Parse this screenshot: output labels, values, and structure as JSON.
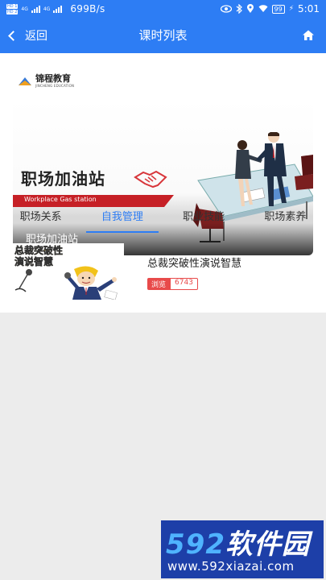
{
  "status_bar": {
    "sim1": "HD 1",
    "sim2": "HD 2",
    "net1": "4G",
    "net2": "4G",
    "speed": "699B/s",
    "battery": "99",
    "time": "5:01"
  },
  "nav": {
    "back_label": "返回",
    "title": "课时列表"
  },
  "logo": {
    "name_cn": "锦程教育",
    "name_en": "JINCHENG EDUCATION"
  },
  "banner": {
    "big_title": "职场加油站",
    "subtitle": "Workplace  Gas station",
    "caption": "职场加油站"
  },
  "tabs": [
    {
      "label": "职场关系",
      "active": false
    },
    {
      "label": "自我管理",
      "active": true
    },
    {
      "label": "职业技能",
      "active": false
    },
    {
      "label": "职场素养",
      "active": false
    }
  ],
  "lessons": [
    {
      "thumb_text_line1": "总裁突破性",
      "thumb_text_line2": "演说智慧",
      "title": "总裁突破性演说智慧",
      "views_label": "浏览",
      "views": "6743"
    }
  ],
  "watermark": {
    "brand_num": "592",
    "brand_cn": "软件园",
    "url": "www.592xiazai.com"
  },
  "colors": {
    "primary": "#2d7df4",
    "accent_red": "#e84a4a",
    "banner_red": "#c62026"
  }
}
